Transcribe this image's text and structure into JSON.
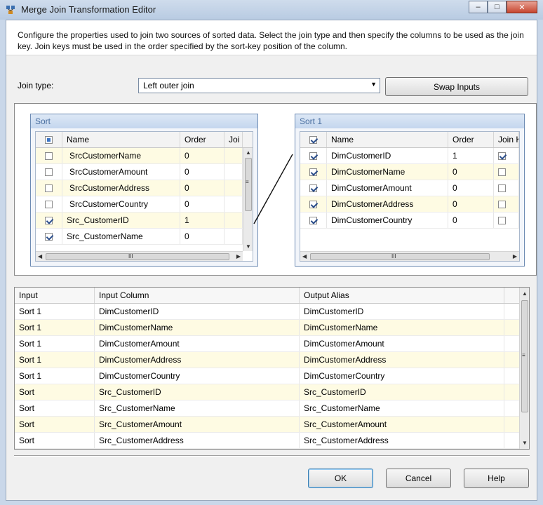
{
  "window": {
    "title": "Merge Join Transformation Editor",
    "minimize": "–",
    "maximize": "□",
    "close": "✕"
  },
  "description": "Configure the properties used to join two sources of sorted data. Select the join type and then specify the columns to be used as the join key. Join keys must be used in the order specified by the sort-key position of the column.",
  "join": {
    "label": "Join type:",
    "selected": "Left outer join",
    "swap_label": "Swap Inputs"
  },
  "left_input": {
    "title": "Sort",
    "columns": [
      "Name",
      "Order",
      "Joi"
    ],
    "rows": [
      {
        "checked": false,
        "name": "SrcCustomerName",
        "order": "0"
      },
      {
        "checked": false,
        "name": "SrcCustomerAmount",
        "order": "0"
      },
      {
        "checked": false,
        "name": "SrcCustomerAddress",
        "order": "0"
      },
      {
        "checked": false,
        "name": "SrcCustomerCountry",
        "order": "0"
      },
      {
        "checked": true,
        "name": "Src_CustomerID",
        "order": "1"
      },
      {
        "checked": true,
        "name": "Src_CustomerName",
        "order": "0"
      }
    ]
  },
  "right_input": {
    "title": "Sort 1",
    "columns": [
      "Name",
      "Order",
      "Join K"
    ],
    "rows": [
      {
        "checked": true,
        "name": "DimCustomerID",
        "order": "1"
      },
      {
        "checked": true,
        "name": "DimCustomerName",
        "order": "0"
      },
      {
        "checked": true,
        "name": "DimCustomerAmount",
        "order": "0"
      },
      {
        "checked": true,
        "name": "DimCustomerAddress",
        "order": "0"
      },
      {
        "checked": true,
        "name": "DimCustomerCountry",
        "order": "0"
      }
    ]
  },
  "output_grid": {
    "columns": [
      "Input",
      "Input Column",
      "Output Alias"
    ],
    "rows": [
      {
        "input": "Sort 1",
        "column": "DimCustomerID",
        "alias": "DimCustomerID"
      },
      {
        "input": "Sort 1",
        "column": "DimCustomerName",
        "alias": "DimCustomerName"
      },
      {
        "input": "Sort 1",
        "column": "DimCustomerAmount",
        "alias": "DimCustomerAmount"
      },
      {
        "input": "Sort 1",
        "column": "DimCustomerAddress",
        "alias": "DimCustomerAddress"
      },
      {
        "input": "Sort 1",
        "column": "DimCustomerCountry",
        "alias": "DimCustomerCountry"
      },
      {
        "input": "Sort",
        "column": "Src_CustomerID",
        "alias": "Src_CustomerID"
      },
      {
        "input": "Sort",
        "column": "Src_CustomerName",
        "alias": "Src_CustomerName"
      },
      {
        "input": "Sort",
        "column": "Src_CustomerAmount",
        "alias": "Src_CustomerAmount"
      },
      {
        "input": "Sort",
        "column": "Src_CustomerAddress",
        "alias": "Src_CustomerAddress"
      }
    ]
  },
  "buttons": {
    "ok": "OK",
    "cancel": "Cancel",
    "help": "Help"
  },
  "icons": {
    "scroll_thumb_grip": "≡",
    "scroll_hthumb_grip": "III",
    "scroll_up": "▲",
    "scroll_down": "▼",
    "scroll_left": "◀",
    "scroll_right": "▶",
    "dropdown_arrow": "▼"
  },
  "colors": {
    "alt_row": "#fefbe3",
    "panel_title_text": "#4a6fa0"
  }
}
